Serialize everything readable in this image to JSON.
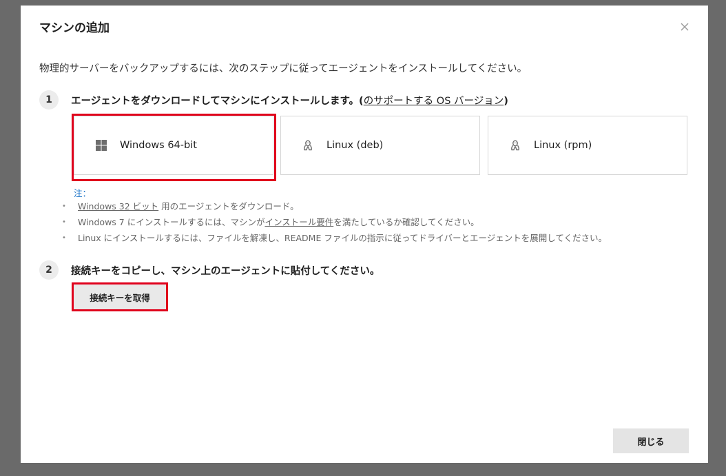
{
  "dialog": {
    "title": "マシンの追加",
    "intro": "物理的サーバーをバックアップするには、次のステップに従ってエージェントをインストールしてください。"
  },
  "step1": {
    "number": "1",
    "text": "エージェントをダウンロードしてマシンにインストールします。",
    "paren_open": "(",
    "link": "のサポートする OS バージョン",
    "paren_close": ")"
  },
  "os_options": [
    {
      "label": "Windows 64-bit",
      "icon": "windows-icon"
    },
    {
      "label": "Linux (deb)",
      "icon": "linux-icon"
    },
    {
      "label": "Linux (rpm)",
      "icon": "linux-icon"
    }
  ],
  "notes": {
    "label": "注：",
    "item1": {
      "link": "Windows 32 ビット",
      "text": " 用のエージェントをダウンロード。"
    },
    "item2": {
      "text_before": "Windows 7 にインストールするには、マシンが",
      "link": "インストール要件",
      "text_after": "を満たしているか確認してください。"
    },
    "item3": {
      "text": "Linux にインストールするには、ファイルを解凍し、README ファイルの指示に従ってドライバーとエージェントを展開してください。"
    }
  },
  "step2": {
    "number": "2",
    "text": "接続キーをコピーし、マシン上のエージェントに貼付してください。",
    "button_label": "接続キーを取得"
  },
  "footer": {
    "close_label": "閉じる"
  },
  "colors": {
    "highlight": "#e0001b",
    "note_label": "#1a73c8",
    "backdrop": "#6a6a6a"
  }
}
